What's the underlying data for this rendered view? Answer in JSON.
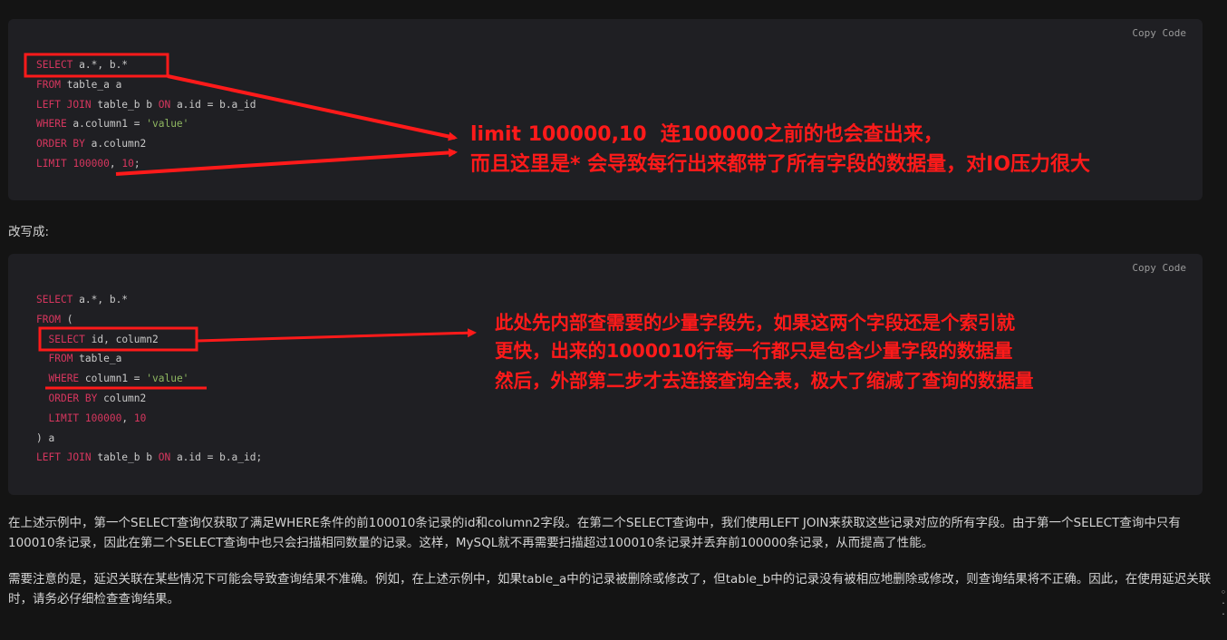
{
  "block1": {
    "copy_label": "Copy Code",
    "lines": [
      [
        {
          "t": "SELECT",
          "c": "kw"
        },
        {
          "t": " a.*, b.*",
          "c": "plain"
        }
      ],
      [
        {
          "t": "FROM",
          "c": "kw"
        },
        {
          "t": " table_a a",
          "c": "plain"
        }
      ],
      [
        {
          "t": "LEFT JOIN",
          "c": "kw"
        },
        {
          "t": " table_b b ",
          "c": "plain"
        },
        {
          "t": "ON",
          "c": "kw"
        },
        {
          "t": " a.id = b.a_id",
          "c": "plain"
        }
      ],
      [
        {
          "t": "WHERE",
          "c": "kw"
        },
        {
          "t": " a.column1 = ",
          "c": "plain"
        },
        {
          "t": "'value'",
          "c": "str"
        }
      ],
      [
        {
          "t": "ORDER BY",
          "c": "kw"
        },
        {
          "t": " a.column2",
          "c": "plain"
        }
      ],
      [
        {
          "t": "LIMIT",
          "c": "kw"
        },
        {
          "t": " ",
          "c": "plain"
        },
        {
          "t": "100000",
          "c": "num"
        },
        {
          "t": ", ",
          "c": "plain"
        },
        {
          "t": "10",
          "c": "num"
        },
        {
          "t": ";",
          "c": "plain"
        }
      ]
    ],
    "annotation": {
      "line1": "limit 100000,10  连100000之前的也会查出来，",
      "line2": "而且这里是* 会导致每行出来都带了所有字段的数据量，对IO压力很大"
    }
  },
  "rewrite_label": "改写成:",
  "block2": {
    "copy_label": "Copy Code",
    "lines": [
      [
        {
          "t": "SELECT",
          "c": "kw"
        },
        {
          "t": " a.*, b.*",
          "c": "plain"
        }
      ],
      [
        {
          "t": "FROM",
          "c": "kw"
        },
        {
          "t": " (",
          "c": "plain"
        }
      ],
      [
        {
          "t": "  ",
          "c": "plain"
        },
        {
          "t": "SELECT",
          "c": "kw"
        },
        {
          "t": " id, column2",
          "c": "plain"
        }
      ],
      [
        {
          "t": "  ",
          "c": "plain"
        },
        {
          "t": "FROM",
          "c": "kw"
        },
        {
          "t": " table_a",
          "c": "plain"
        }
      ],
      [
        {
          "t": "  ",
          "c": "plain"
        },
        {
          "t": "WHERE",
          "c": "kw"
        },
        {
          "t": " column1 = ",
          "c": "plain"
        },
        {
          "t": "'value'",
          "c": "str"
        }
      ],
      [
        {
          "t": "  ",
          "c": "plain"
        },
        {
          "t": "ORDER BY",
          "c": "kw"
        },
        {
          "t": " column2",
          "c": "plain"
        }
      ],
      [
        {
          "t": "  ",
          "c": "plain"
        },
        {
          "t": "LIMIT",
          "c": "kw"
        },
        {
          "t": " ",
          "c": "plain"
        },
        {
          "t": "100000",
          "c": "num"
        },
        {
          "t": ", ",
          "c": "plain"
        },
        {
          "t": "10",
          "c": "num"
        }
      ],
      [
        {
          "t": ") a",
          "c": "plain"
        }
      ],
      [
        {
          "t": "LEFT JOIN",
          "c": "kw"
        },
        {
          "t": " table_b b ",
          "c": "plain"
        },
        {
          "t": "ON",
          "c": "kw"
        },
        {
          "t": " a.id = b.a_id;",
          "c": "plain"
        }
      ]
    ],
    "annotation": {
      "line1": "此处先内部查需要的少量字段先，如果这两个字段还是个索引就",
      "line2": "更快，出来的1000010行每一行都只是包含少量字段的数据量",
      "line3": "然后，外部第二步才去连接查询全表，极大了缩减了查询的数据量"
    }
  },
  "paragraphs": [
    "在上述示例中，第一个SELECT查询仅获取了满足WHERE条件的前100010条记录的id和column2字段。在第二个SELECT查询中，我们使用LEFT JOIN来获取这些记录对应的所有字段。由于第一个SELECT查询中只有100010条记录，因此在第二个SELECT查询中也只会扫描相同数量的记录。这样，MySQL就不再需要扫描超过100010条记录并丢弃前100000条记录，从而提高了性能。",
    "需要注意的是，延迟关联在某些情况下可能会导致查询结果不准确。例如，在上述示例中，如果table_a中的记录被删除或修改了，但table_b中的记录没有被相应地删除或修改，则查询结果将不正确。因此，在使用延迟关联时，请务必仔细检查查询结果。"
  ],
  "colors": {
    "annotation_red": "#ff1a1a",
    "keyword": "#d6365e",
    "string": "#8fb861",
    "background": "#141414",
    "code_background": "#1f1f23"
  }
}
